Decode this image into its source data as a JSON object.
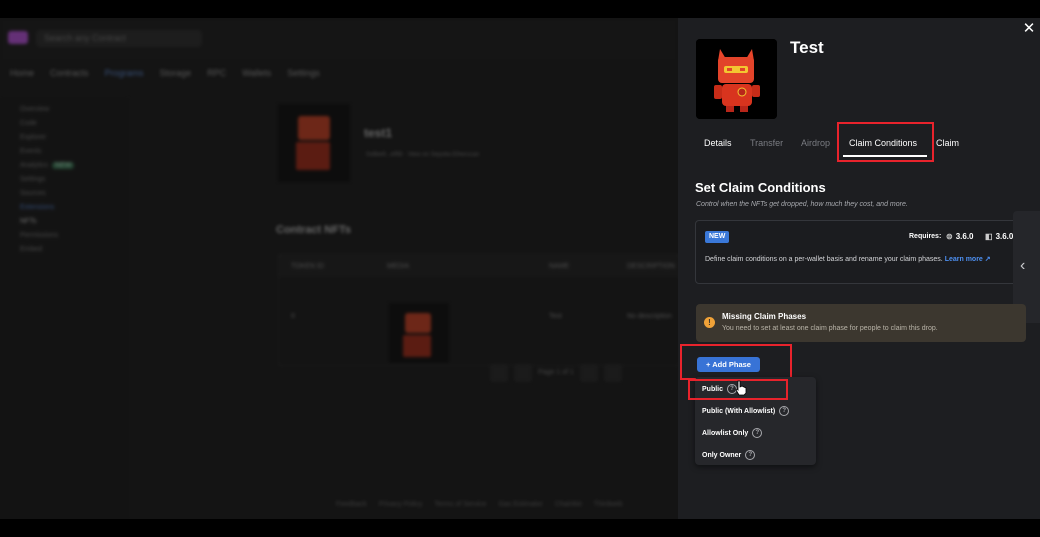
{
  "background": {
    "search_placeholder": "Search any Contract",
    "nav": [
      "Home",
      "Contracts",
      "Programs",
      "Storage",
      "RPC",
      "Wallets",
      "Settings"
    ],
    "sidebar": [
      "Overview",
      "Code",
      "Explorer",
      "Events",
      "Analytics",
      "Settings",
      "Sources",
      "Extensions",
      "NFTs",
      "Permissions",
      "Embed"
    ],
    "sidebar_badge": "NEW",
    "contract_title": "test1",
    "contract_sub": "0x8be9...ef56   ·   View on Sepolia Etherscan",
    "section": "Contract NFTs",
    "table_headers": [
      "TOKEN ID",
      "MEDIA",
      "NAME",
      "DESCRIPTION"
    ],
    "table_row": [
      "0",
      "",
      "Test",
      "No description"
    ],
    "pager_text": "Page 1 of 1",
    "footer": [
      "Feedback",
      "Privacy Policy",
      "Terms of Service",
      "Gas Estimator",
      "Chainlist",
      "Thirdweb"
    ]
  },
  "drawer": {
    "close_icon": "close-icon",
    "nft_title": "Test",
    "tabs": [
      {
        "label": "Details",
        "active": false
      },
      {
        "label": "Transfer",
        "active": false
      },
      {
        "label": "Airdrop",
        "active": false
      },
      {
        "label": "Claim Conditions",
        "active": true
      },
      {
        "label": "Claim",
        "active": false
      }
    ],
    "section_title": "Set Claim Conditions",
    "section_desc": "Control when the NFTs get dropped, how much they cost, and more.",
    "info_card": {
      "badge": "NEW",
      "requires_label": "Requires:",
      "versions": [
        "3.6.0",
        "3.6.0"
      ],
      "text": "Define claim conditions on a per-wallet basis and rename your claim phases. ",
      "link": "Learn more ↗"
    },
    "warning": {
      "title": "Missing Claim Phases",
      "text": "You need to set at least one claim phase for people to claim this drop."
    },
    "add_phase_label": "+ Add Phase",
    "dropdown_options": [
      "Public",
      "Public (With Allowlist)",
      "Allowlist Only",
      "Only Owner"
    ]
  },
  "colors": {
    "accent": "#3873d6",
    "highlight": "#e8232c",
    "drawer_bg": "#1d1e21",
    "warning_bg": "#3c372f"
  }
}
